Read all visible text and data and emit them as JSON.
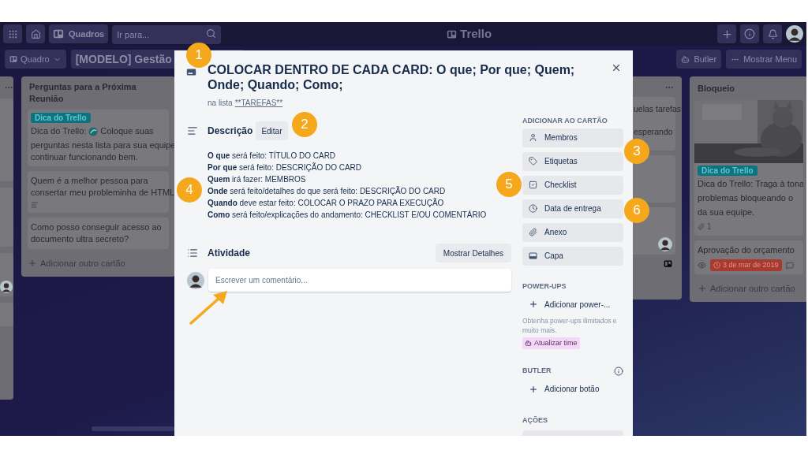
{
  "topbar": {
    "boards_button": "Quadros",
    "search_placeholder": "Ir para...",
    "logo": "Trello"
  },
  "board_header": {
    "board_menu": "Quadro",
    "board_title": "[MODELO] Gestão",
    "butler": "Butler",
    "menu": "Mostrar Menu"
  },
  "list_questions": {
    "title": "Perguntas para a Próxima Reunião",
    "tip_card": {
      "label": "Dica do Trello",
      "prefix": "Dica do Trello:",
      "first_line": "Coloque suas",
      "rest": "perguntas nesta lista para sua equipe continuar funcionando bem."
    },
    "cards": [
      {
        "text": "Quem é a melhor pessoa para consertar meu probleminha de HTML",
        "has_description": true
      },
      {
        "text": "Como posso conseguir acesso ao documento ultra secreto?",
        "has_description": false
      }
    ],
    "add_card": "Adicionar outro cartão"
  },
  "list_hidden": {
    "card_lines": [
      "uelas tarefas",
      "esperando"
    ]
  },
  "list_blocked": {
    "title": "Bloqueio",
    "tip_card": {
      "label": "Dica do Trello",
      "lines": [
        "Dica do Trello: Traga à tona",
        "problemas bloqueando o",
        "da sua equipe."
      ],
      "attachments": "1"
    },
    "budget_card": {
      "title": "Aprovação do orçamento",
      "due": "3 de mar de 2019",
      "overdue": true
    },
    "add_card": "Adicionar outro cartão"
  },
  "card_modal": {
    "title": "COLOCAR DENTRO DE CADA CARD: O que; Por que; Quem; Onde; Quando; Como;",
    "list_prefix": "na lista",
    "list_link": "**TAREFAS**",
    "description": {
      "heading": "Descrição",
      "edit_button": "Editar",
      "lines": [
        "**O que** será feito: TÍTULO DO CARD",
        "**Por que** será feito: DESCRIÇÃO DO CARD",
        "**Quem** irá fazer: MEMBROS",
        "**Onde** será feito/detalhes do que será feito: DESCRIÇÃO DO CARD",
        "**Quando** deve estar feito: COLOCAR O PRAZO PARA EXECUÇÃO",
        "**Como** será feito/explicações do andamento: CHECKLIST E/OU COMENTÁRIO"
      ]
    },
    "activity": {
      "heading": "Atividade",
      "details_button": "Mostrar Detalhes",
      "comment_placeholder": "Escrever um comentário..."
    },
    "sidebar": {
      "add_heading": "ADICIONAR AO CARTÃO",
      "add_buttons": [
        {
          "kind": "person",
          "label": "Membros"
        },
        {
          "kind": "tag",
          "label": "Etiquetas"
        },
        {
          "kind": "checklist",
          "label": "Checklist"
        },
        {
          "kind": "clock",
          "label": "Data de entrega"
        },
        {
          "kind": "paperclip",
          "label": "Anexo"
        },
        {
          "kind": "cover",
          "label": "Capa"
        }
      ],
      "powerups_heading": "POWER-UPS",
      "add_powerup": "Adicionar power-...",
      "promo": "Obtenha power-ups ilimitados e muito mais.",
      "upgrade": "Atualizar time",
      "butler_heading": "BUTLER",
      "add_butler_button": "Adicionar botão",
      "actions_heading": "AÇÕES"
    }
  },
  "annotations": [
    {
      "label": "1"
    },
    {
      "label": "2"
    },
    {
      "label": "3"
    },
    {
      "label": "4"
    },
    {
      "label": "5"
    },
    {
      "label": "6"
    }
  ]
}
